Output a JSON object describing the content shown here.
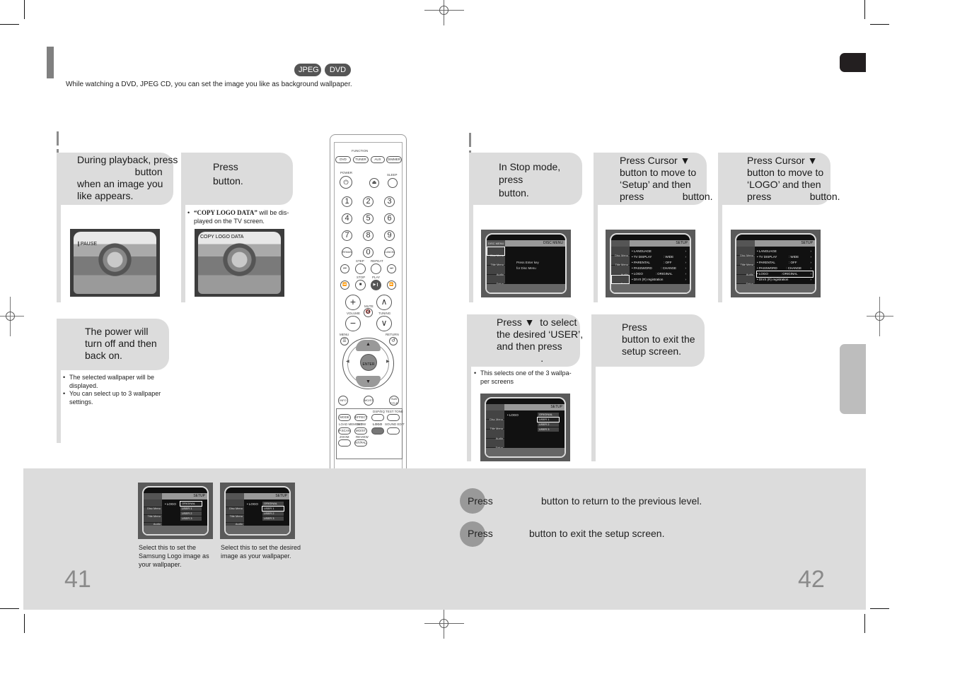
{
  "header": {
    "badges": [
      "JPEG",
      "DVD"
    ],
    "intro": "While watching a DVD, JPEG CD, you can set the image you like as background wallpaper."
  },
  "left_section": {
    "steps": [
      {
        "lines": [
          "During playback, press",
          "                     button",
          "when an image you",
          "like appears."
        ],
        "screen_overlay": "❙PAUSE"
      },
      {
        "lines": [
          "Press",
          "button."
        ],
        "note_quote": "“COPY LOGO DATA”",
        "note_rest": " will be dis-",
        "note_line2": "played on the TV screen.",
        "screen_overlay": "COPY LOGO DATA"
      },
      {
        "lines": [
          "The power will",
          "turn off and then",
          "back on."
        ],
        "notes": [
          "The selected wallpaper will be",
          "displayed.",
          "You can select up to 3 wallpaper",
          "settings."
        ]
      }
    ]
  },
  "right_section": {
    "steps": [
      {
        "lines": [
          "In Stop mode,",
          "press",
          "button."
        ]
      },
      {
        "lines": [
          "Press Cursor ▼",
          "button to move to",
          "‘Setup’ and then",
          "press              button."
        ]
      },
      {
        "lines": [
          "Press Cursor ▼",
          "button to move to",
          "‘LOGO’ and then",
          "press              button."
        ]
      },
      {
        "lines": [
          "Press ▼  to select",
          "the desired ‘USER’,",
          "and then press",
          "                ."
        ],
        "notes": [
          "This selects one of the 3 wallpa-",
          "per screens"
        ]
      },
      {
        "lines": [
          "Press",
          "button to exit the",
          "setup screen."
        ]
      }
    ]
  },
  "tv_screens": {
    "disc_menu": {
      "header_left": "DISC MENU",
      "header_right": "DISC MENU",
      "side": [
        "Disc Menu",
        "Title Menu",
        "Audio",
        "Setup"
      ],
      "message": [
        "Press Enter key",
        "for Disc Menu"
      ]
    },
    "setup_menu": {
      "header_right": "SETUP",
      "side": [
        "Disc Menu",
        "Title Menu",
        "Audio",
        "Setup"
      ],
      "items": [
        {
          "label": "• LANGUAGE",
          "value": ""
        },
        {
          "label": "• TV  DISPLAY",
          "value": ": WIDE"
        },
        {
          "label": "• PARENTAL",
          "value": ": OFF"
        },
        {
          "label": "• PASSWORD",
          "value": ": CHANGE"
        },
        {
          "label": "• LOGO",
          "value": ": ORIGINAL"
        },
        {
          "label": "• DIVX (R) registration",
          "value": ""
        }
      ]
    },
    "logo_menu": {
      "header_right": "SETUP",
      "label": "• LOGO",
      "options": [
        "ORIGINAL",
        "USER 1",
        "USER 2",
        "USER 3"
      ],
      "side": [
        "Disc Menu",
        "Title Menu",
        "Audio",
        "Setup"
      ]
    }
  },
  "remote": {
    "function_label": "FUNCTION",
    "function_buttons": [
      "DVD",
      "TUNER",
      "AUX",
      "DIMMER"
    ],
    "labels": {
      "power": "POWER",
      "sleep": "SLEEP",
      "step": "STEP",
      "repeat": "REPEAT",
      "stop": "STOP",
      "play": "PLAY",
      "mute": "MUTE",
      "volume": "VOLUME",
      "tuning": "TUNING",
      "menu": "MENU",
      "return": "RETURN",
      "enter": "ENTER"
    },
    "numbers": [
      "1",
      "2",
      "3",
      "4",
      "5",
      "6",
      "7",
      "8",
      "9",
      "REMAIN",
      "0",
      "CANCEL"
    ],
    "bottom_row": [
      "INFO",
      "MO/ST",
      "SUB TITLE"
    ],
    "lower_block": {
      "row1": [
        "MODE",
        "EFFECT",
        "TEST TONE"
      ],
      "row1_labels": [
        "DSP/EQ",
        "TEST TONE"
      ],
      "row2_labels": [
        "LOAD MEMORY",
        "SLOW",
        "LOGO",
        "SOUND EDIT"
      ],
      "row2": [
        "P.SCAN",
        "MO/ST"
      ],
      "row3_labels": [
        "ZOOM",
        "REVIEW"
      ],
      "row3": [
        "NT/PAL"
      ]
    }
  },
  "bottom_band": {
    "captions": [
      [
        "Select this to set the",
        "Samsung Logo image as",
        "your wallpaper."
      ],
      [
        "Select this to set the desired",
        "image as your wallpaper."
      ]
    ],
    "press_rows": [
      {
        "press": "Press",
        "text": "button to return to the previous level."
      },
      {
        "press": "Press",
        "text": "button to exit the setup screen."
      }
    ],
    "page_left": "41",
    "page_right": "42"
  }
}
